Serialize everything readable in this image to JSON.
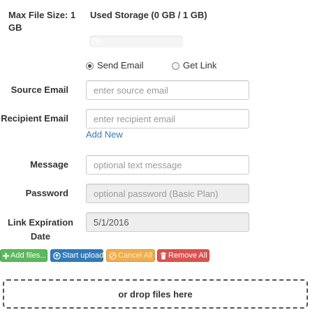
{
  "limits": {
    "max_file_size": "Max File Size: 1 GB",
    "used_storage": "Used Storage (0 GB / 1 GB)",
    "progress_text": "0%",
    "progress_fraction": 0.0
  },
  "delivery": {
    "options": [
      {
        "label": "Send Email",
        "selected": true
      },
      {
        "label": "Get Link",
        "selected": false
      }
    ]
  },
  "form": {
    "source_email": {
      "label": "Source Email",
      "placeholder": "enter source email",
      "value": ""
    },
    "recipient_email": {
      "label": "Recipient Email",
      "placeholder": "enter recipient email",
      "value": ""
    },
    "add_new": "Add New",
    "message": {
      "label": "Message",
      "placeholder": "optional text message",
      "value": ""
    },
    "password": {
      "label": "Password",
      "placeholder": "optional password (Basic Plan)",
      "value": ""
    },
    "expiration": {
      "label": "Link Expiration Date",
      "value": "5/1/2016"
    }
  },
  "buttons": {
    "add_files": "Add files...",
    "start_upload": "Start upload",
    "cancel_all": "Cancel All",
    "remove_all": "Remove All"
  },
  "dropzone": {
    "text": "or drop files here"
  },
  "colors": {
    "add_files": "#5cb85c",
    "start_upload": "#337ab7",
    "cancel_all": "#f0ad4e",
    "remove_all": "#d9534f",
    "link": "#337ab7"
  }
}
